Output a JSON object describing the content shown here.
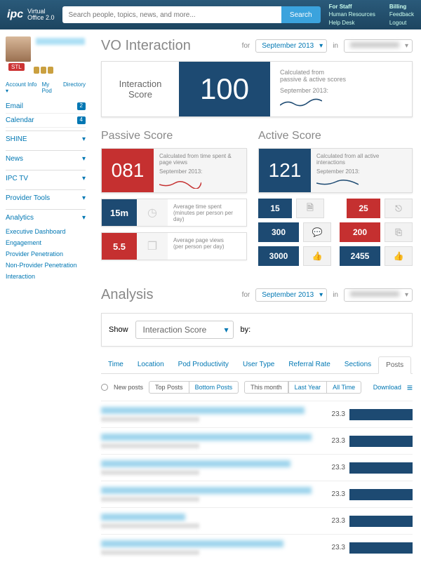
{
  "topbar": {
    "brand1": "ipc",
    "brand2a": "Virtual",
    "brand2b": "Office 2.0",
    "search_placeholder": "Search people, topics, news, and more...",
    "search_btn": "Search",
    "links": {
      "c1h": "For Staff",
      "c1a": "Human Resources",
      "c1b": "Help Desk",
      "c2h": "Billing",
      "c2a": "Feedback",
      "c2b": "Logout"
    }
  },
  "sidebar": {
    "stl": "STL",
    "nav": {
      "a": "Account Info ▾",
      "b": "My Pod",
      "c": "Directory"
    },
    "email": {
      "label": "Email",
      "count": "2"
    },
    "calendar": {
      "label": "Calendar",
      "count": "4"
    },
    "secs": {
      "shine": "SHINE",
      "news": "News",
      "ipctv": "IPC TV",
      "prov": "Provider Tools",
      "analytics": "Analytics"
    },
    "sub": {
      "a": "Executive Dashboard",
      "b": "Engagement",
      "c": "Provider Penetration",
      "d": "Non-Provider Penetration",
      "e": "Interaction"
    }
  },
  "page": {
    "title": "VO Interaction",
    "for": "for",
    "in": "in",
    "month": "September 2013",
    "interaction_label": "Interaction Score",
    "interaction_value": "100",
    "calc_from": "Calculated from",
    "calc_pa": "passive & active scores",
    "sep": "September 2013:",
    "passive_h": "Passive Score",
    "passive_val": "081",
    "passive_desc": "Calculated from time spent & page views",
    "p1_val": "15m",
    "p1_txt1": "Average time spent",
    "p1_txt2": "(minutes per person per day)",
    "p2_val": "5.5",
    "p2_txt1": "Average page views",
    "p2_txt2": "(per person per day)",
    "active_h": "Active Score",
    "active_val": "121",
    "active_desc": "Calculated from all active interactions",
    "a1": "15",
    "a2": "25",
    "a3": "300",
    "a4": "200",
    "a5": "3000",
    "a6": "2455"
  },
  "analysis": {
    "title": "Analysis",
    "show": "Show",
    "by": "by:",
    "metric": "Interaction Score",
    "tabs": {
      "time": "Time",
      "loc": "Location",
      "pod": "Pod Productivity",
      "user": "User Type",
      "ref": "Referral Rate",
      "sec": "Sections",
      "posts": "Posts"
    },
    "newposts": "New posts",
    "top": "Top Posts",
    "bottom": "Bottom Posts",
    "month": "This month",
    "year": "Last Year",
    "all": "All Time",
    "download": "Download",
    "rows": [
      "23.3",
      "23.3",
      "23.3",
      "23.3",
      "23.3",
      "23.3"
    ]
  }
}
